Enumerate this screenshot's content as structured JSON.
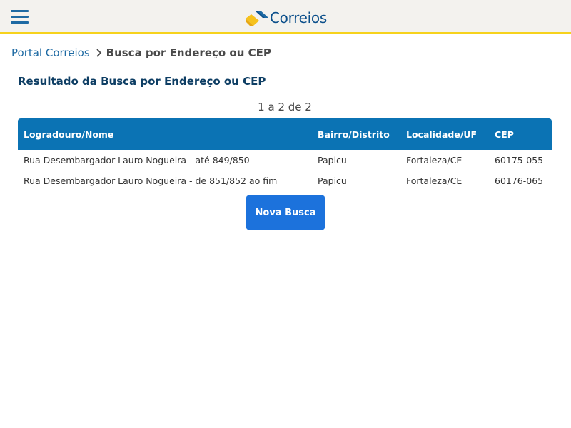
{
  "header": {
    "logo_text": "Correios"
  },
  "breadcrumb": {
    "home": "Portal Correios",
    "current": "Busca por Endereço ou CEP"
  },
  "result": {
    "title": "Resultado da Busca por Endereço ou CEP",
    "pager": "1 a 2 de 2"
  },
  "table": {
    "columns": [
      "Logradouro/Nome",
      "Bairro/Distrito",
      "Localidade/UF",
      "CEP"
    ],
    "rows": [
      {
        "logradouro": "Rua Desembargador Lauro Nogueira - até 849/850",
        "bairro": "Papicu",
        "localidade": "Fortaleza/CE",
        "cep": "60175-055"
      },
      {
        "logradouro": "Rua Desembargador Lauro Nogueira - de 851/852 ao fim",
        "bairro": "Papicu",
        "localidade": "Fortaleza/CE",
        "cep": "60176-065"
      }
    ]
  },
  "actions": {
    "new_search": "Nova Busca"
  },
  "colors": {
    "brand_blue": "#0b73b4",
    "brand_yellow": "#f6d21c",
    "button_blue": "#1c72dc"
  },
  "icons": {
    "menu": "hamburger-menu-icon",
    "separator": "chevron-right-icon",
    "logo": "correios-logo-icon"
  }
}
